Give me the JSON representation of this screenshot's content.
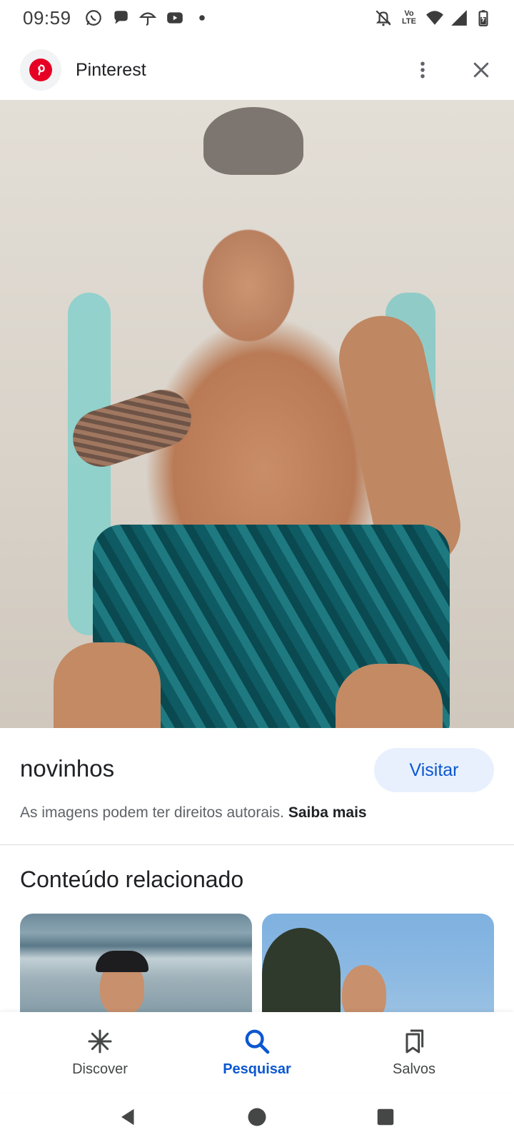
{
  "status_bar": {
    "time": "09:59",
    "lte_label_top": "Vo",
    "lte_label_bottom": "LTE",
    "left_icons": [
      "whatsapp-icon",
      "chat-bubble-icon",
      "umbrella-icon",
      "youtube-icon",
      "dot-icon"
    ],
    "right_icons": [
      "mute-icon",
      "volte-icon",
      "wifi-icon",
      "signal-icon",
      "battery-icon"
    ]
  },
  "header": {
    "source_name": "Pinterest",
    "logo_icon": "pinterest-icon",
    "menu_icon": "more-vert-icon",
    "close_icon": "close-icon"
  },
  "main_image": {
    "lens_icon": "google-lens-icon"
  },
  "info": {
    "title": "novinhos",
    "visit_label": "Visitar",
    "copyright_text": "As imagens podem ter direitos autorais.",
    "learn_more": "Saiba mais"
  },
  "related": {
    "title": "Conteúdo relacionado"
  },
  "bottom_nav": {
    "items": [
      {
        "label": "Discover",
        "icon": "asterisk-icon",
        "active": false
      },
      {
        "label": "Pesquisar",
        "icon": "search-icon",
        "active": true
      },
      {
        "label": "Salvos",
        "icon": "bookmarks-icon",
        "active": false
      }
    ]
  },
  "colors": {
    "accent": "#0b57d0",
    "visit_bg": "#e8f0fe",
    "pinterest_red": "#e60023"
  }
}
